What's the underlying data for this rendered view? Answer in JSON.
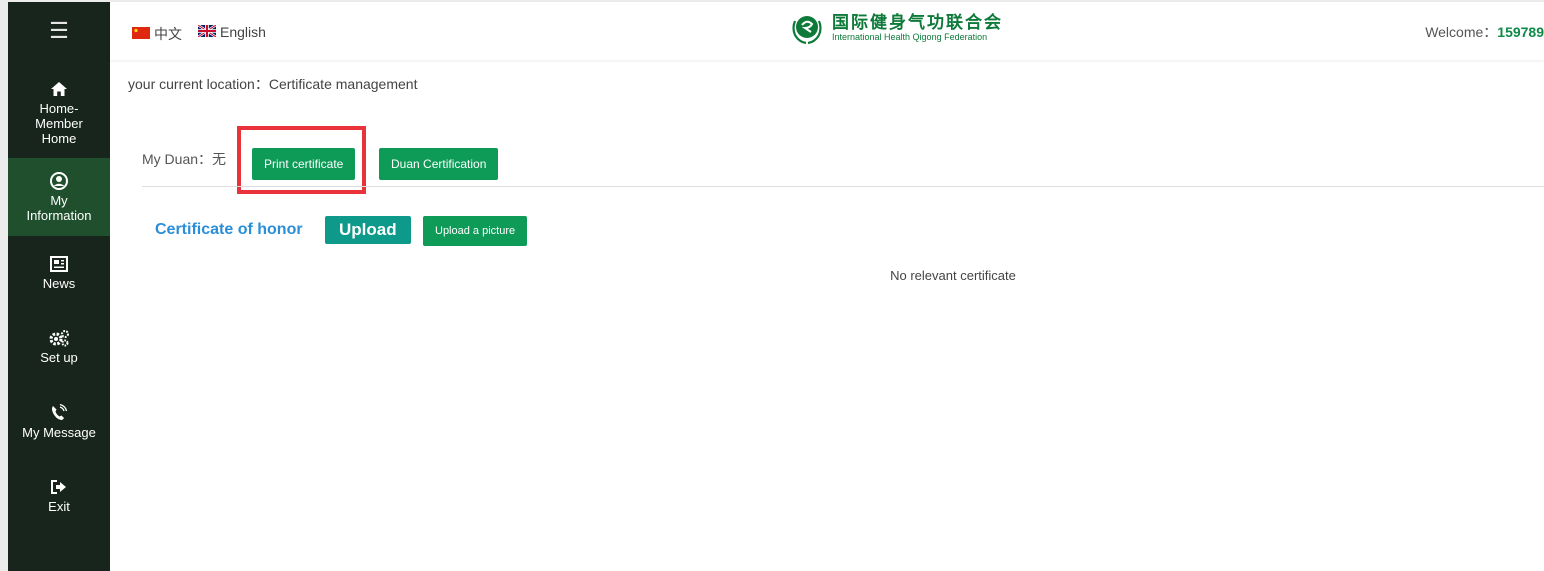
{
  "sidebar": {
    "menu_icon": "hamburger-icon",
    "items": [
      {
        "label": "Home-\nMember\nHome",
        "icon": "home-icon"
      },
      {
        "label": "My\nInformation",
        "icon": "user-circle-icon"
      },
      {
        "label": "News",
        "icon": "newspaper-icon"
      },
      {
        "label": "Set up",
        "icon": "gears-icon"
      },
      {
        "label": "My Message",
        "icon": "phone-ringing-icon"
      },
      {
        "label": "Exit",
        "icon": "sign-out-icon"
      }
    ]
  },
  "header": {
    "lang_zh": "中文",
    "lang_en": "English",
    "logo_cn": "国际健身气功联合会",
    "logo_en": "International Health Qigong Federation",
    "welcome_label": "Welcome：",
    "user_id": "159789"
  },
  "main": {
    "location": "your current location：Certificate management",
    "duan_label": "My Duan：无",
    "print_button": "Print certificate",
    "duan_button": "Duan Certification",
    "honor_title": "Certificate of honor",
    "upload_button": "Upload",
    "upload_picture_button": "Upload a picture",
    "empty_message": "No relevant certificate"
  },
  "colors": {
    "sidebar_bg": "#17251c",
    "sidebar_active": "#1f4f2d",
    "primary_green": "#0e9a57",
    "teal": "#0e9a8a",
    "blue_title": "#2a8fd8",
    "highlight_red": "#e8333a"
  }
}
